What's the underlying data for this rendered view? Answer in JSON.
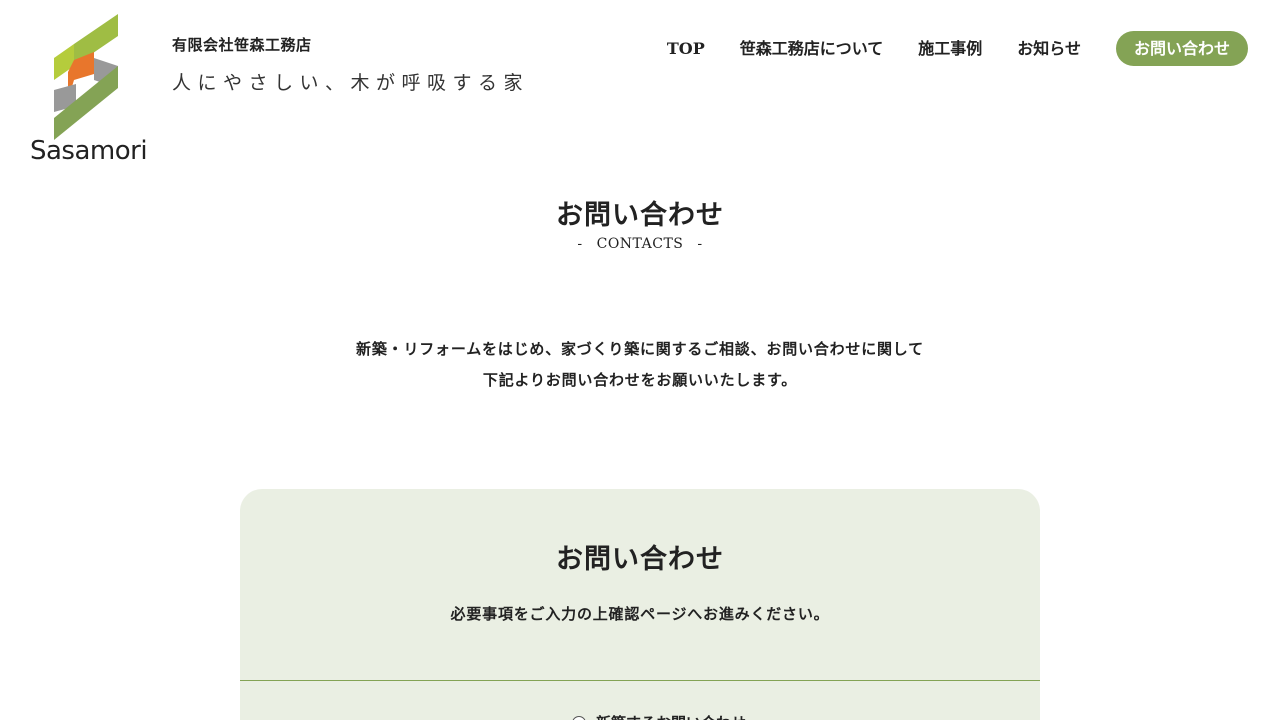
{
  "brand": {
    "logo_text": "Sasamori",
    "company_name": "有限会社笹森工務店",
    "tagline": "人にやさしい、木が呼吸する家",
    "colors": {
      "green": "#84a355",
      "lime": "#b5cc3c",
      "orange": "#e8762c",
      "gray": "#999999"
    }
  },
  "nav": {
    "items": [
      "TOP",
      "笹森工務店について",
      "施工事例",
      "お知らせ"
    ],
    "cta": "お問い合わせ",
    "cta_color": "#84a355"
  },
  "page": {
    "title": "お問い合わせ",
    "subtitle_dash": "-",
    "subtitle": "CONTACTS",
    "intro_line1": "新築・リフォームをはじめ、家づくり築に関するご相談、お問い合わせに関して",
    "intro_line2": "下記よりお問い合わせをお願いいたします。"
  },
  "form": {
    "title": "お問い合わせ",
    "description": "必要事項をご入力の上確認ページへお進みください。",
    "panel_color": "#eaefe3",
    "first_option": "新築するお問い合わせ"
  }
}
